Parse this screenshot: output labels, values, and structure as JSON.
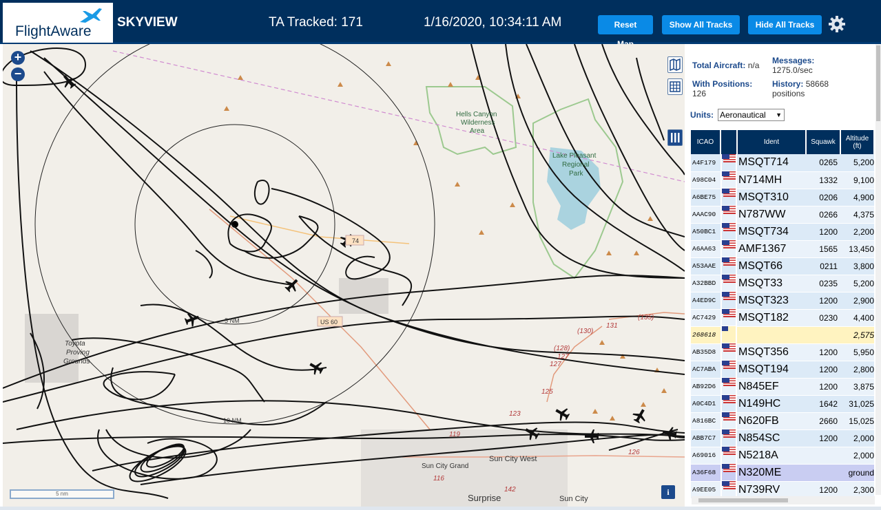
{
  "header": {
    "brand": "FlightAware",
    "title": "SKYVIEW",
    "tracked": "TA Tracked: 171",
    "datetime": "1/16/2020, 10:34:11 AM",
    "reset_label": "Reset Map",
    "show_label": "Show All Tracks",
    "hide_label": "Hide All Tracks"
  },
  "map": {
    "labels": {
      "area1": "Hells Canyon",
      "area2": "Wilderness",
      "area3": "Area",
      "lake1": "Lake Pleasant",
      "lake2": "Regional",
      "lake3": "Park",
      "range1": "Toyota",
      "range2": "Proving",
      "range3": "Grounds",
      "ring5": "5 NM",
      "ring10": "10 NM",
      "road74": "74",
      "road60": "US 60",
      "town_scw": "Sun City West",
      "town_scg": "Sun City Grand",
      "town_surprise": "Surprise",
      "town_sc": "Sun City",
      "r131": "131",
      "r135": "(135)",
      "r130": "(130)",
      "r128": "(128)",
      "r127": "127",
      "r125": "125",
      "r123": "123",
      "r119": "119",
      "r116": "116",
      "r142": "142",
      "r126": "126"
    },
    "scale_label": "5 nm",
    "info_label": "i",
    "zoom_in": "+",
    "zoom_out": "−"
  },
  "sidebar": {
    "total_label": "Total Aircraft:",
    "total_value": "n/a",
    "messages_label": "Messages:",
    "messages_value": "1275.0/sec",
    "positions_label": "With Positions:",
    "positions_value": "126",
    "history_label": "History:",
    "history_value": "58668",
    "history_unit": "positions",
    "units_label": "Units:",
    "units_value": "Aeronautical",
    "columns": {
      "icao": "ICAO",
      "ident": "Ident",
      "squawk": "Squawk",
      "altitude": "Altitude",
      "altitude_unit": "(ft)"
    },
    "rows": [
      {
        "icao": "A4F179",
        "ident": "MSQT714",
        "squawk": "0265",
        "alt": "5,200"
      },
      {
        "icao": "A98C04",
        "ident": "N714MH",
        "squawk": "1332",
        "alt": "9,100"
      },
      {
        "icao": "A6BE75",
        "ident": "MSQT310",
        "squawk": "0206",
        "alt": "4,900"
      },
      {
        "icao": "AAAC90",
        "ident": "N787WW",
        "squawk": "0266",
        "alt": "4,375"
      },
      {
        "icao": "A50BC1",
        "ident": "MSQT734",
        "squawk": "1200",
        "alt": "2,200"
      },
      {
        "icao": "A6AA63",
        "ident": "AMF1367",
        "squawk": "1565",
        "alt": "13,450"
      },
      {
        "icao": "A53AAE",
        "ident": "MSQT66",
        "squawk": "0211",
        "alt": "3,800"
      },
      {
        "icao": "A32BBD",
        "ident": "MSQT33",
        "squawk": "0235",
        "alt": "5,200"
      },
      {
        "icao": "A4ED9C",
        "ident": "MSQT323",
        "squawk": "1200",
        "alt": "2,900"
      },
      {
        "icao": "AC7429",
        "ident": "MSQT182",
        "squawk": "0230",
        "alt": "4,400"
      },
      {
        "icao": "268618",
        "ident": "",
        "squawk": "",
        "alt": "2,575"
      },
      {
        "icao": "AB35D8",
        "ident": "MSQT356",
        "squawk": "1200",
        "alt": "5,950"
      },
      {
        "icao": "AC7ABA",
        "ident": "MSQT194",
        "squawk": "1200",
        "alt": "2,800"
      },
      {
        "icao": "AB92D6",
        "ident": "N845EF",
        "squawk": "1200",
        "alt": "3,875"
      },
      {
        "icao": "A0C4D1",
        "ident": "N149HC",
        "squawk": "1642",
        "alt": "31,025"
      },
      {
        "icao": "A816BC",
        "ident": "N620FB",
        "squawk": "2660",
        "alt": "15,025"
      },
      {
        "icao": "ABB7C7",
        "ident": "N854SC",
        "squawk": "1200",
        "alt": "2,000"
      },
      {
        "icao": "A69016",
        "ident": "N5218A",
        "squawk": "",
        "alt": "2,000"
      },
      {
        "icao": "A36F68",
        "ident": "N320ME",
        "squawk": "",
        "alt": "ground"
      },
      {
        "icao": "A9EE05",
        "ident": "N739RV",
        "squawk": "1200",
        "alt": "2,300"
      }
    ]
  }
}
